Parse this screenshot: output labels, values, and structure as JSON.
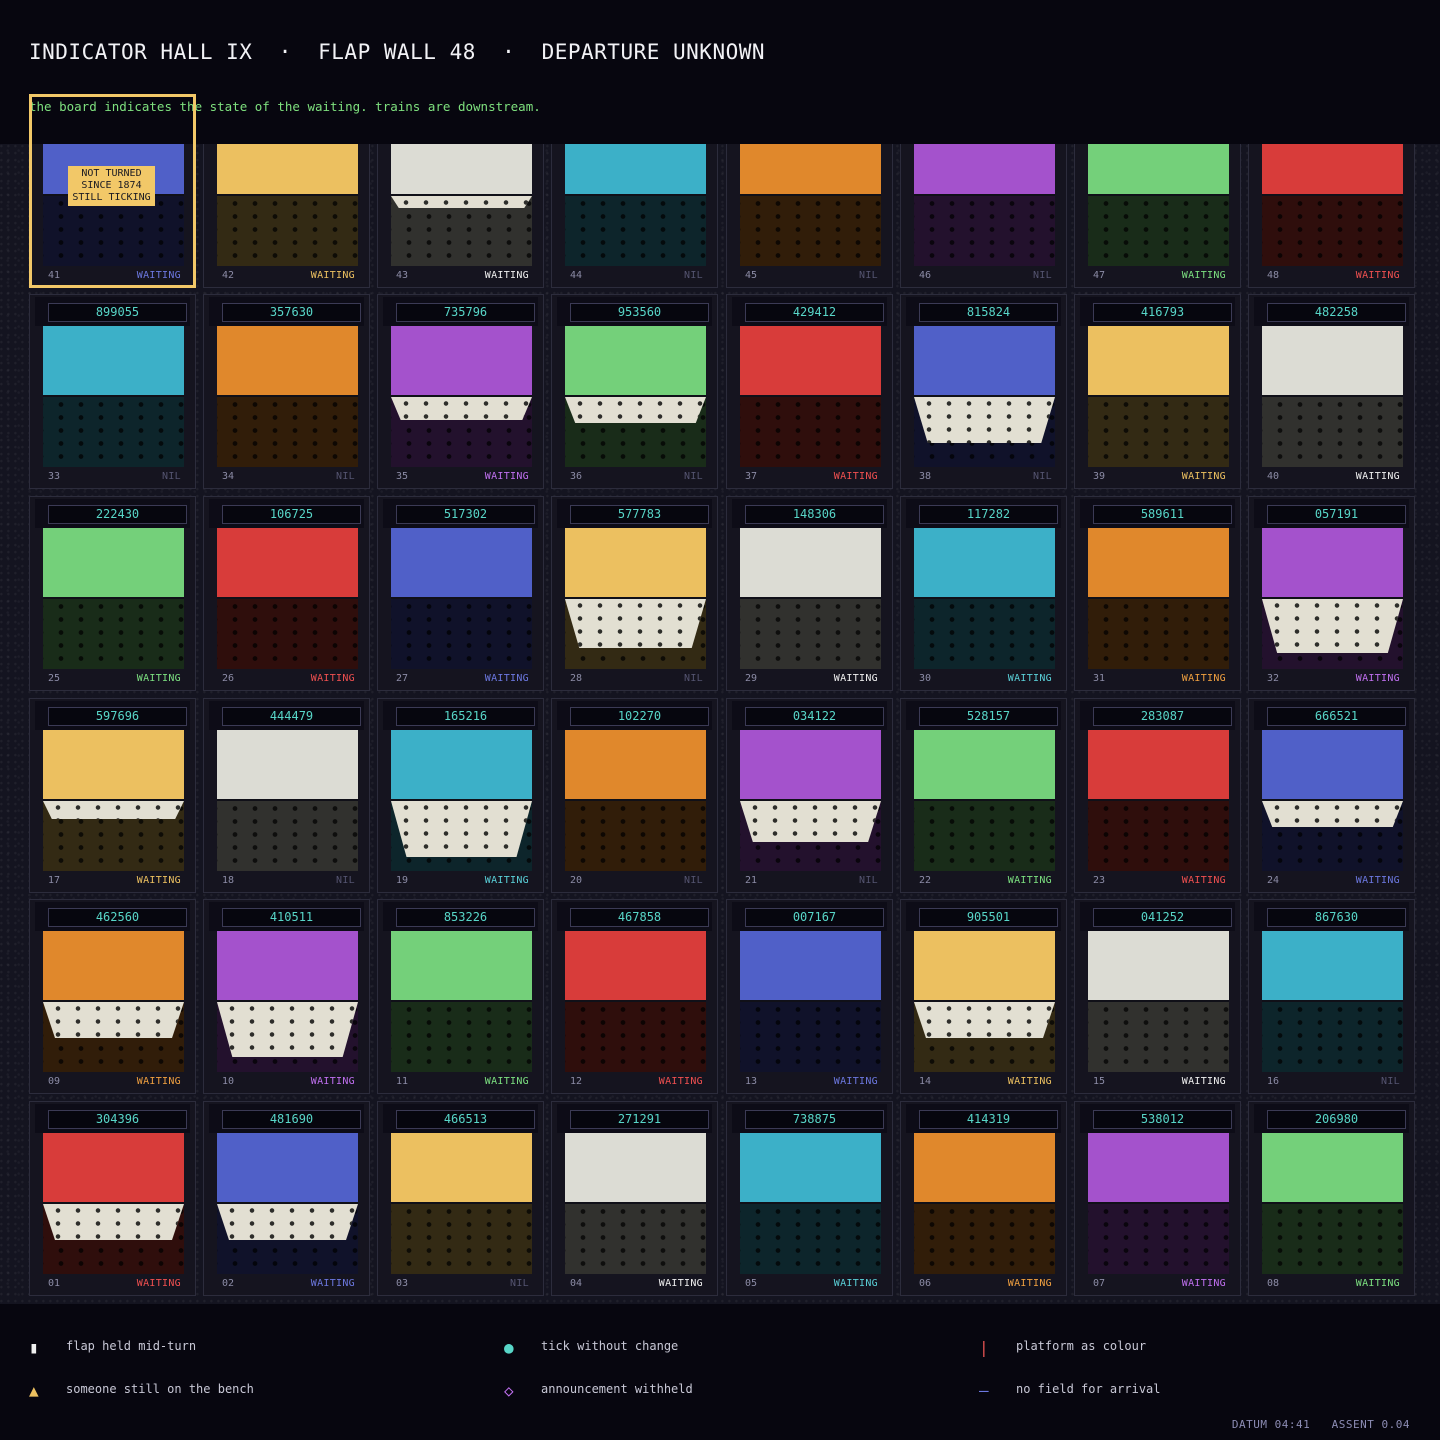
{
  "title": "INDICATOR HALL IX  ·  FLAP WALL 48  ·  DEPARTURE UNKNOWN",
  "subtitle": "the board indicates the state of the waiting. trains are downstream.",
  "note": "NOT TURNED SINCE 1874 STILL TICKING",
  "palette": {
    "indigo": [
      "#5060c8",
      "#24285e"
    ],
    "gold": [
      "#ecc060",
      "#705e2c"
    ],
    "ivory": [
      "#dcdcd4",
      "#6c6c66"
    ],
    "cyan": [
      "#3cb0c8",
      "#1c5260"
    ],
    "orange": [
      "#e0882c",
      "#6c4014"
    ],
    "violet": [
      "#a452cc",
      "#4e2664"
    ],
    "green": [
      "#74d07a",
      "#386238"
    ],
    "red": [
      "#d83c3a",
      "#681e1a"
    ]
  },
  "status_colors": {
    "indigo": "#6c78e0",
    "gold": "#ecc060",
    "ivory": "#f0f0f0",
    "cyan": "#5ad0d8",
    "orange": "#f0a040",
    "violet": "#c070f0",
    "green": "#7ce080",
    "red": "#f05050",
    "nil": "#545470"
  },
  "rows": [
    [
      {
        "num": "41",
        "code": "",
        "color": "indigo",
        "status": "WAITING",
        "held": 0
      },
      {
        "num": "42",
        "code": "",
        "color": "gold",
        "status": "WAITING",
        "held": 0
      },
      {
        "num": "43",
        "code": "",
        "color": "ivory",
        "status": "WAITING",
        "held": 12
      },
      {
        "num": "44",
        "code": "",
        "color": "cyan",
        "status": "NIL",
        "held": 0
      },
      {
        "num": "45",
        "code": "",
        "color": "orange",
        "status": "NIL",
        "held": 0
      },
      {
        "num": "46",
        "code": "",
        "color": "violet",
        "status": "NIL",
        "held": 0
      },
      {
        "num": "47",
        "code": "",
        "color": "green",
        "status": "WAITING",
        "held": 0
      },
      {
        "num": "48",
        "code": "",
        "color": "red",
        "status": "WAITING",
        "held": 0
      }
    ],
    [
      {
        "num": "33",
        "code": "899055",
        "color": "cyan",
        "status": "NIL",
        "held": 0
      },
      {
        "num": "34",
        "code": "357630",
        "color": "orange",
        "status": "NIL",
        "held": 0
      },
      {
        "num": "35",
        "code": "735796",
        "color": "violet",
        "status": "WAITING",
        "held": 23
      },
      {
        "num": "36",
        "code": "953560",
        "color": "green",
        "status": "NIL",
        "held": 26
      },
      {
        "num": "37",
        "code": "429412",
        "color": "red",
        "status": "WAITING",
        "held": 0
      },
      {
        "num": "38",
        "code": "815824",
        "color": "indigo",
        "status": "NIL",
        "held": 46
      },
      {
        "num": "39",
        "code": "416793",
        "color": "gold",
        "status": "WAITING",
        "held": 0
      },
      {
        "num": "40",
        "code": "482258",
        "color": "ivory",
        "status": "WAITING",
        "held": 0
      }
    ],
    [
      {
        "num": "25",
        "code": "222430",
        "color": "green",
        "status": "WAITING",
        "held": 0
      },
      {
        "num": "26",
        "code": "106725",
        "color": "red",
        "status": "WAITING",
        "held": 0
      },
      {
        "num": "27",
        "code": "517302",
        "color": "indigo",
        "status": "WAITING",
        "held": 0
      },
      {
        "num": "28",
        "code": "577783",
        "color": "gold",
        "status": "NIL",
        "held": 49
      },
      {
        "num": "29",
        "code": "148306",
        "color": "ivory",
        "status": "WAITING",
        "held": 0
      },
      {
        "num": "30",
        "code": "117282",
        "color": "cyan",
        "status": "WAITING",
        "held": 0
      },
      {
        "num": "31",
        "code": "589611",
        "color": "orange",
        "status": "WAITING",
        "held": 0
      },
      {
        "num": "32",
        "code": "057191",
        "color": "violet",
        "status": "WAITING",
        "held": 54
      }
    ],
    [
      {
        "num": "17",
        "code": "597696",
        "color": "gold",
        "status": "WAITING",
        "held": 18
      },
      {
        "num": "18",
        "code": "444479",
        "color": "ivory",
        "status": "NIL",
        "held": 0
      },
      {
        "num": "19",
        "code": "165216",
        "color": "cyan",
        "status": "WAITING",
        "held": 56
      },
      {
        "num": "20",
        "code": "102270",
        "color": "orange",
        "status": "NIL",
        "held": 0
      },
      {
        "num": "21",
        "code": "034122",
        "color": "violet",
        "status": "NIL",
        "held": 41
      },
      {
        "num": "22",
        "code": "528157",
        "color": "green",
        "status": "WAITING",
        "held": 0
      },
      {
        "num": "23",
        "code": "283087",
        "color": "red",
        "status": "WAITING",
        "held": 0
      },
      {
        "num": "24",
        "code": "666521",
        "color": "indigo",
        "status": "WAITING",
        "held": 26
      }
    ],
    [
      {
        "num": "09",
        "code": "462560",
        "color": "orange",
        "status": "WAITING",
        "held": 36
      },
      {
        "num": "10",
        "code": "410511",
        "color": "violet",
        "status": "WAITING",
        "held": 55
      },
      {
        "num": "11",
        "code": "853226",
        "color": "green",
        "status": "WAITING",
        "held": 0
      },
      {
        "num": "12",
        "code": "467858",
        "color": "red",
        "status": "WAITING",
        "held": 0
      },
      {
        "num": "13",
        "code": "007167",
        "color": "indigo",
        "status": "WAITING",
        "held": 0
      },
      {
        "num": "14",
        "code": "905501",
        "color": "gold",
        "status": "WAITING",
        "held": 36
      },
      {
        "num": "15",
        "code": "041252",
        "color": "ivory",
        "status": "WAITING",
        "held": 0
      },
      {
        "num": "16",
        "code": "867630",
        "color": "cyan",
        "status": "NIL",
        "held": 0
      }
    ],
    [
      {
        "num": "01",
        "code": "304396",
        "color": "red",
        "status": "WAITING",
        "held": 36
      },
      {
        "num": "02",
        "code": "481690",
        "color": "indigo",
        "status": "WAITING",
        "held": 36
      },
      {
        "num": "03",
        "code": "466513",
        "color": "gold",
        "status": "NIL",
        "held": 0
      },
      {
        "num": "04",
        "code": "271291",
        "color": "ivory",
        "status": "WAITING",
        "held": 0
      },
      {
        "num": "05",
        "code": "738875",
        "color": "cyan",
        "status": "WAITING",
        "held": 0
      },
      {
        "num": "06",
        "code": "414319",
        "color": "orange",
        "status": "WAITING",
        "held": 0
      },
      {
        "num": "07",
        "code": "538012",
        "color": "violet",
        "status": "WAITING",
        "held": 0
      },
      {
        "num": "08",
        "code": "206980",
        "color": "green",
        "status": "WAITING",
        "held": 0
      }
    ]
  ],
  "legend": [
    {
      "icon": "▮",
      "icon_name": "held-flap-icon",
      "color": "#f0f0f0",
      "label": "flap held mid-turn"
    },
    {
      "icon": "●",
      "icon_name": "tick-dot-icon",
      "color": "#58d6c8",
      "label": "tick without change"
    },
    {
      "icon": "|",
      "icon_name": "platform-bar-icon",
      "color": "#e05050",
      "label": "platform as colour"
    },
    {
      "icon": "▲",
      "icon_name": "bench-triangle-icon",
      "color": "#ecc060",
      "label": "someone still on the bench"
    },
    {
      "icon": "◇",
      "icon_name": "withheld-diamond-icon",
      "color": "#c070f0",
      "label": "announcement withheld"
    },
    {
      "icon": "—",
      "icon_name": "no-arrival-dash-icon",
      "color": "#6c78e0",
      "label": "no field for arrival"
    }
  ],
  "footer": "DATUM 04:41   ASSENT 0.04"
}
